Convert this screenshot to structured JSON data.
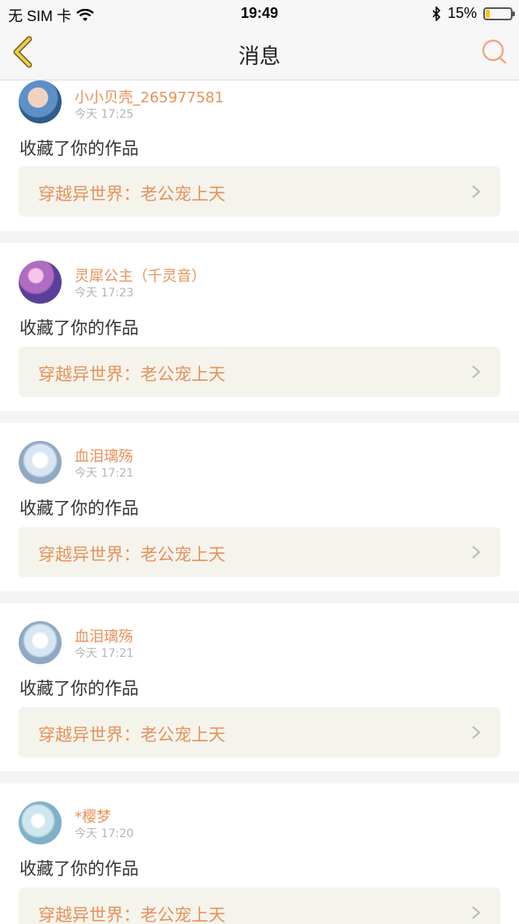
{
  "status_bar": {
    "carrier": "无 SIM 卡",
    "time": "19:49",
    "battery": "15%",
    "battery_level": 0.15,
    "icons": [
      "wifi-icon",
      "bluetooth-icon",
      "battery-icon"
    ]
  },
  "nav": {
    "title": "消息",
    "accent_color": "#e8915a",
    "back_icon": "back-chevron-icon",
    "search_icon": "search-icon"
  },
  "messages": [
    {
      "username": "小小贝壳_265977581",
      "time": "今天 17:25",
      "action": "收藏了你的作品",
      "work_title": "穿越异世界：老公宠上天"
    },
    {
      "username": "灵犀公主（千灵音）",
      "time": "今天 17:23",
      "action": "收藏了你的作品",
      "work_title": "穿越异世界：老公宠上天"
    },
    {
      "username": "血泪璃殇",
      "time": "今天 17:21",
      "action": "收藏了你的作品",
      "work_title": "穿越异世界：老公宠上天"
    },
    {
      "username": "血泪璃殇",
      "time": "今天 17:21",
      "action": "收藏了你的作品",
      "work_title": "穿越异世界：老公宠上天"
    },
    {
      "username": "*樱梦",
      "time": "今天 17:20",
      "action": "收藏了你的作品",
      "work_title": "穿越异世界：老公宠上天"
    }
  ]
}
